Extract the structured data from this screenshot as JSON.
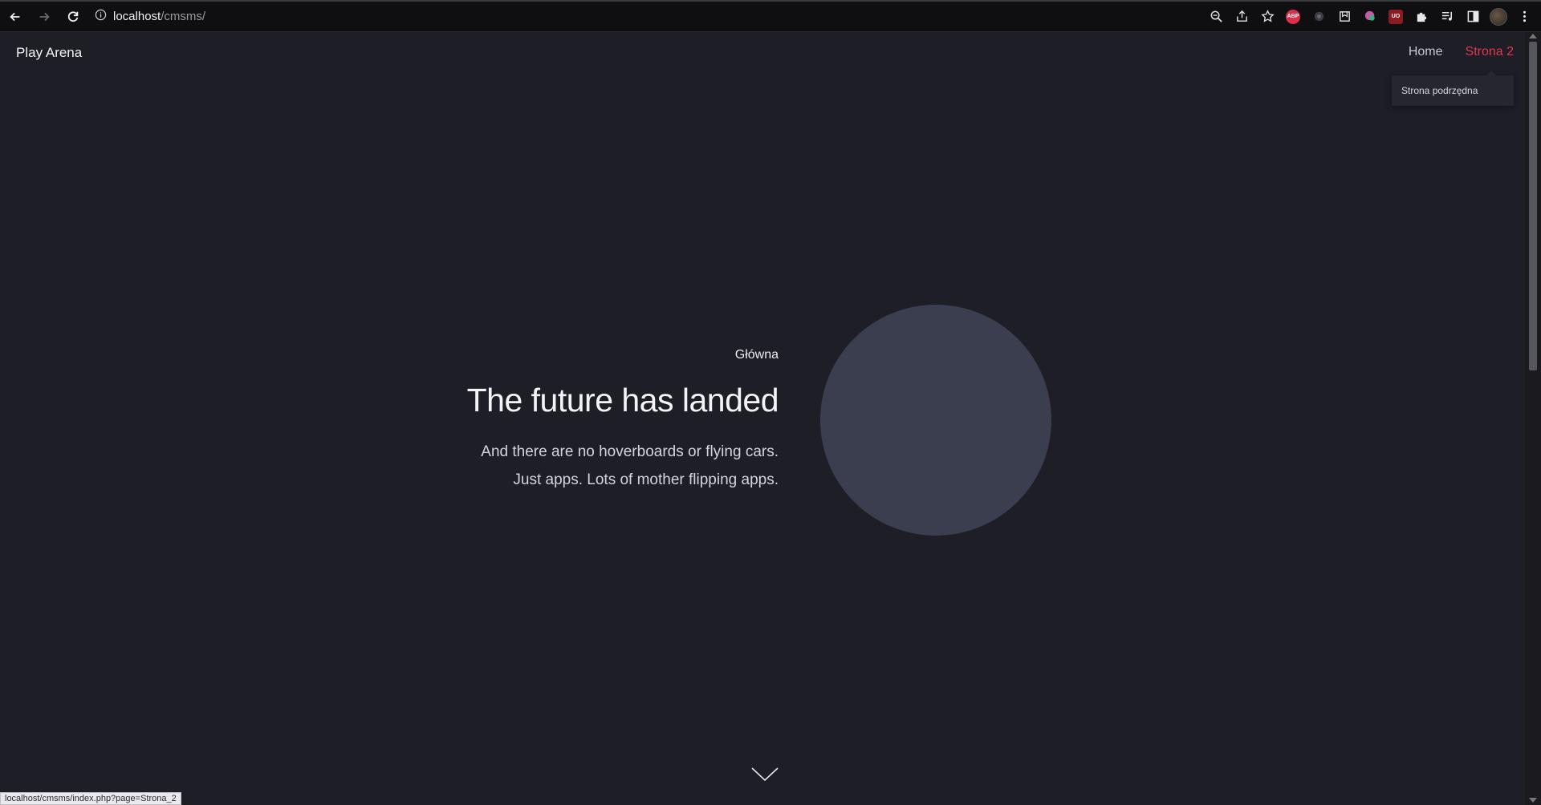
{
  "browser": {
    "url_host": "localhost",
    "url_path": "/cmsms/",
    "extensions": {
      "abp": "ABP",
      "ublock": "UO"
    }
  },
  "site": {
    "brand": "Play Arena",
    "nav": [
      {
        "label": "Home",
        "active": false
      },
      {
        "label": "Strona 2",
        "active": true
      }
    ],
    "dropdown_item": "Strona podrzędna"
  },
  "hero": {
    "eyebrow": "Główna",
    "title": "The future has landed",
    "subtitle_line1": "And there are no hoverboards or flying cars.",
    "subtitle_line2": "Just apps. Lots of mother flipping apps."
  },
  "status_bar": "localhost/cmsms/index.php?page=Strona_2",
  "colors": {
    "background": "#1d1e26",
    "accent": "#e2374e",
    "circle": "#3b3e4f"
  },
  "icons": {
    "back": "arrow-left-icon",
    "forward": "arrow-right-icon",
    "reload": "reload-icon",
    "info": "info-icon",
    "zoom": "zoom-icon",
    "share": "share-icon",
    "bookmark": "star-icon",
    "extensions": "puzzle-icon",
    "media": "media-control-icon",
    "sidepanel": "side-panel-icon",
    "menu": "kebab-menu-icon",
    "scroll": "chevron-down-icon"
  }
}
